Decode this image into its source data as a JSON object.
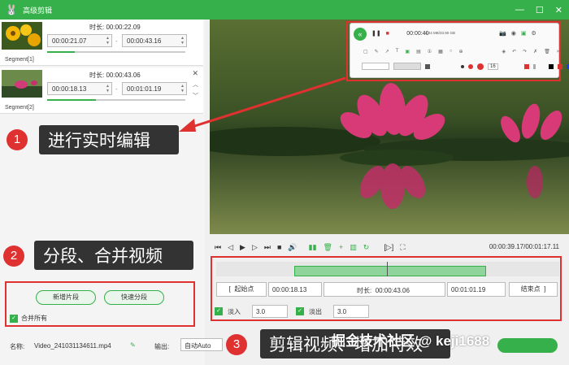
{
  "window": {
    "title": "高级剪辑",
    "logo_icon": "rabbit-icon"
  },
  "segments": [
    {
      "label": "Segment[1]",
      "duration_label": "时长:",
      "duration": "00:00:22.09",
      "start": "00:00:21.07",
      "end": "00:00:43.16",
      "progress": 0.2
    },
    {
      "label": "Segment[2]",
      "duration_label": "时长:",
      "duration": "00:00:43.06",
      "start": "00:00:18.13",
      "end": "00:01:01.19",
      "progress": 0.35
    }
  ],
  "left_actions": {
    "new_segment": "新增片段",
    "quick_split": "快速分段",
    "merge_all": "合并所有"
  },
  "recorder": {
    "time": "00:00:40",
    "size": "4.44 MB/33.90 GB",
    "font_size": "16"
  },
  "callouts": [
    {
      "num": "1",
      "text": "进行实时编辑"
    },
    {
      "num": "2",
      "text": "分段、合并视频"
    },
    {
      "num": "3",
      "text": "剪辑视频、增加特效"
    }
  ],
  "player": {
    "time": "00:00:39.17/00:01:17.11"
  },
  "trim": {
    "start_label": "起始点",
    "start": "00:00:18.13",
    "duration_label": "时长:",
    "duration": "00:00:43.06",
    "end": "00:01:01.19",
    "end_label": "结束点"
  },
  "fade": {
    "in_label": "淡入",
    "in_value": "3.0",
    "out_label": "淡出",
    "out_value": "3.0"
  },
  "footer": {
    "name_label": "名称:",
    "filename": "Video_241031134611.mp4",
    "output_label": "输出:",
    "output_value": "自动Auto"
  },
  "watermark": "掘金技术社区 @ keji1688"
}
